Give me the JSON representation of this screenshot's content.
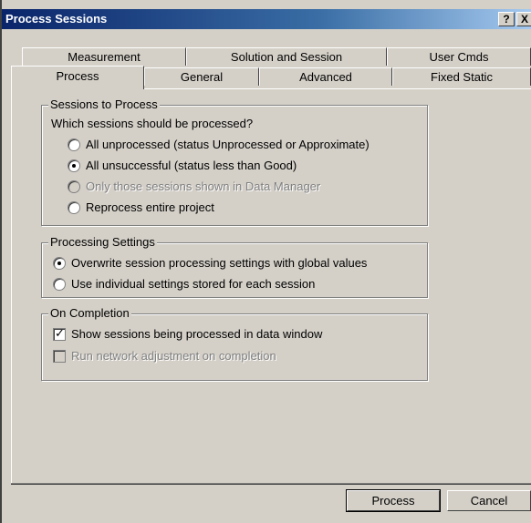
{
  "window": {
    "title": "Process Sessions",
    "help_label": "?",
    "close_label": "X"
  },
  "tabs_back": [
    {
      "label": "Measurement"
    },
    {
      "label": "Solution and Session"
    },
    {
      "label": "User Cmds"
    }
  ],
  "tabs_front": [
    {
      "label": "Process",
      "active": true
    },
    {
      "label": "General"
    },
    {
      "label": "Advanced"
    },
    {
      "label": "Fixed Static"
    }
  ],
  "sessions": {
    "title": "Sessions to Process",
    "question": "Which sessions should be processed?",
    "options": [
      {
        "label": "All unprocessed (status Unprocessed or Approximate)",
        "selected": false,
        "enabled": true
      },
      {
        "label": "All unsuccessful (status less than Good)",
        "selected": true,
        "enabled": true
      },
      {
        "label": "Only those sessions shown in Data Manager",
        "selected": false,
        "enabled": false
      },
      {
        "label": "Reprocess entire project",
        "selected": false,
        "enabled": true
      }
    ]
  },
  "settings": {
    "title": "Processing Settings",
    "options": [
      {
        "label": "Overwrite session processing settings with global values",
        "selected": true
      },
      {
        "label": "Use individual settings stored for each session",
        "selected": false
      }
    ]
  },
  "completion": {
    "title": "On Completion",
    "options": [
      {
        "label": "Show sessions being processed in data window",
        "checked": true,
        "enabled": true
      },
      {
        "label": "Run network adjustment on completion",
        "checked": false,
        "enabled": false
      }
    ]
  },
  "buttons": {
    "process": "Process",
    "cancel": "Cancel"
  }
}
